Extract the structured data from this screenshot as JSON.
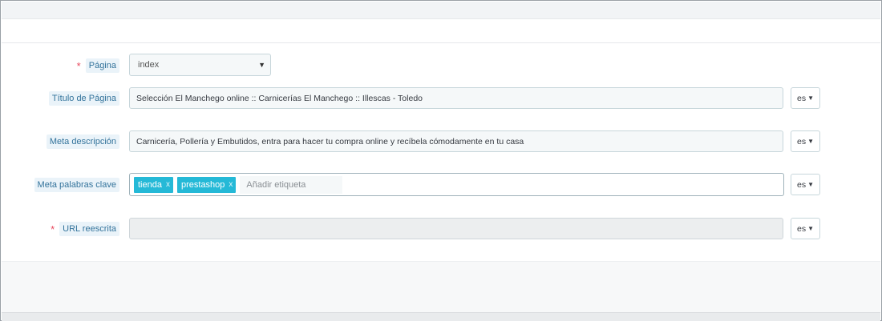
{
  "form": {
    "page": {
      "label": "Página",
      "required_mark": "*",
      "value": "index",
      "caret": "▼"
    },
    "title": {
      "label": "Título de Página",
      "value": "Selección El Manchego online :: Carnicerías El Manchego :: Illescas - Toledo",
      "lang": "es"
    },
    "description": {
      "label": "Meta descripción",
      "value": "Carnicería, Pollería y Embutidos, entra para hacer tu compra online y recíbela cómodamente en tu casa",
      "lang": "es"
    },
    "keywords": {
      "label": "Meta palabras clave",
      "tags": [
        "tienda",
        "prestashop"
      ],
      "tag_remove": "x",
      "placeholder": "Añadir etiqueta",
      "lang": "es"
    },
    "url": {
      "label": "URL reescrita",
      "required_mark": "*",
      "value": "",
      "lang": "es"
    },
    "lang_caret": "▼"
  },
  "colors": {
    "label_bg": "#eaf3f9",
    "label_text": "#33739b",
    "tag_bg": "#25b9d7",
    "required": "#e84a5f"
  }
}
